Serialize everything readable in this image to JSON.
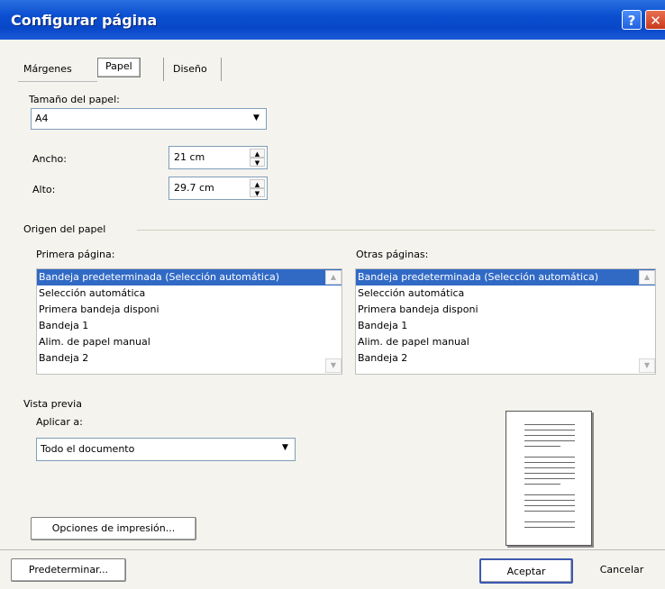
{
  "window": {
    "title": "Configurar página",
    "help_label": "?",
    "close_label": "✕"
  },
  "tabs": [
    {
      "label": "Márgenes",
      "active": false
    },
    {
      "label": "Papel",
      "active": true
    },
    {
      "label": "Diseño",
      "active": false
    }
  ],
  "paper_size": {
    "label": "Tamaño del papel:",
    "value": "A4"
  },
  "width": {
    "label": "Ancho:",
    "value": "21 cm"
  },
  "height": {
    "label": "Alto:",
    "value": "29.7 cm"
  },
  "paper_source": {
    "section_label": "Origen del papel",
    "first_page": {
      "label": "Primera página:",
      "items": [
        "Bandeja predeterminada (Selección automática)",
        "Selección automática",
        "Primera bandeja disponi",
        "Bandeja 1",
        "Alim. de papel manual",
        "Bandeja 2"
      ],
      "selected_index": 0
    },
    "other_pages": {
      "label": "Otras páginas:",
      "items": [
        "Bandeja predeterminada (Selección automática)",
        "Selección automática",
        "Primera bandeja disponi",
        "Bandeja 1",
        "Alim. de papel manual",
        "Bandeja 2"
      ],
      "selected_index": 0
    }
  },
  "preview": {
    "section_label": "Vista previa",
    "apply_label": "Aplicar a:",
    "apply_value": "Todo el documento"
  },
  "buttons": {
    "print_options": "Opciones de impresión...",
    "default": "Predeterminar...",
    "ok": "Aceptar",
    "cancel": "Cancelar"
  },
  "icons": {
    "dropdown": "▼",
    "spin_up": "▲",
    "spin_down": "▼",
    "scroll_up": "▲",
    "scroll_down": "▼"
  },
  "colors": {
    "title_bar": "#0a4fd0",
    "selection": "#316ac5",
    "dialog_bg": "#f4f3ee"
  }
}
